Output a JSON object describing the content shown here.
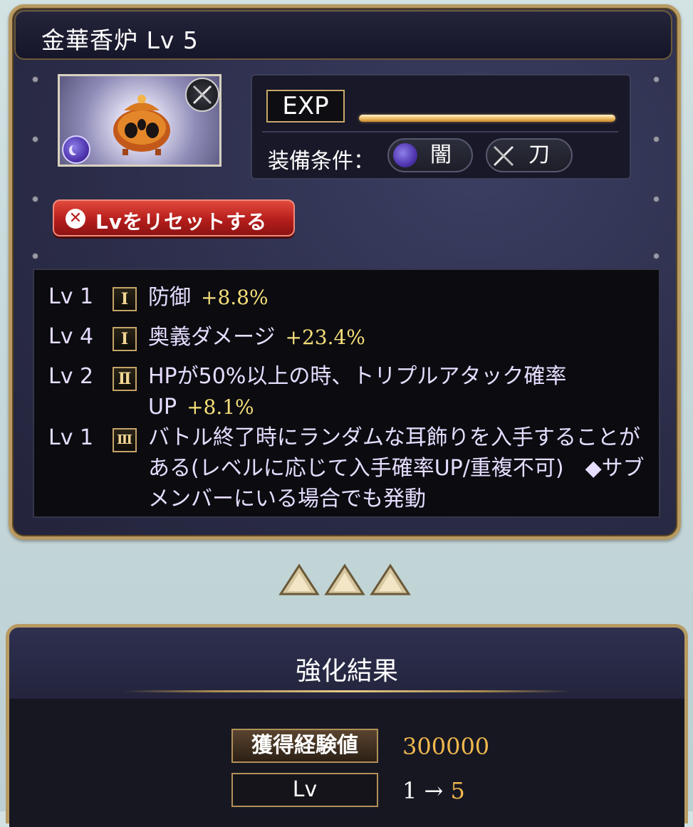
{
  "header": {
    "title": "金華香炉 Lv 5"
  },
  "item": {
    "element_icon": "dark-element-icon",
    "weapon_icon": "katana-icon"
  },
  "info": {
    "exp_label": "EXP",
    "exp_progress": 1.0,
    "equip_label": "装備条件：",
    "conditions": [
      {
        "icon": "dark-element-icon",
        "label": "闇"
      },
      {
        "icon": "katana-icon",
        "label": "刀"
      }
    ]
  },
  "reset_button": {
    "label": "Lvをリセットする",
    "icon": "close-circle-icon"
  },
  "skills": [
    {
      "lv": "Lv 1",
      "rank": "Ⅰ",
      "desc": "防御",
      "value": "+8.8%"
    },
    {
      "lv": "Lv 4",
      "rank": "Ⅰ",
      "desc": "奥義ダメージ",
      "value": "+23.4%"
    },
    {
      "lv": "Lv 2",
      "rank": "Ⅱ",
      "desc": "HPが50%以上の時、トリプルアタック確率UP",
      "value": "+8.1%"
    },
    {
      "lv": "Lv 1",
      "rank": "Ⅲ",
      "desc": "バトル終了時にランダムな耳飾りを入手することがある(レベルに応じて入手確率UP/重複不可)　◆サブメンバーにいる場合でも発動",
      "value": ""
    }
  ],
  "result": {
    "title": "強化結果",
    "exp_label": "獲得経験値",
    "exp_value": "300000",
    "lv_label": "Lv",
    "lv_from": "1",
    "lv_arrow": "→",
    "lv_to": "5"
  },
  "colors": {
    "frame_gold": "#b89a62",
    "value_yellow": "#f6df7a",
    "accent_orange": "#f0b84e",
    "reset_red": "#b51e1c"
  }
}
